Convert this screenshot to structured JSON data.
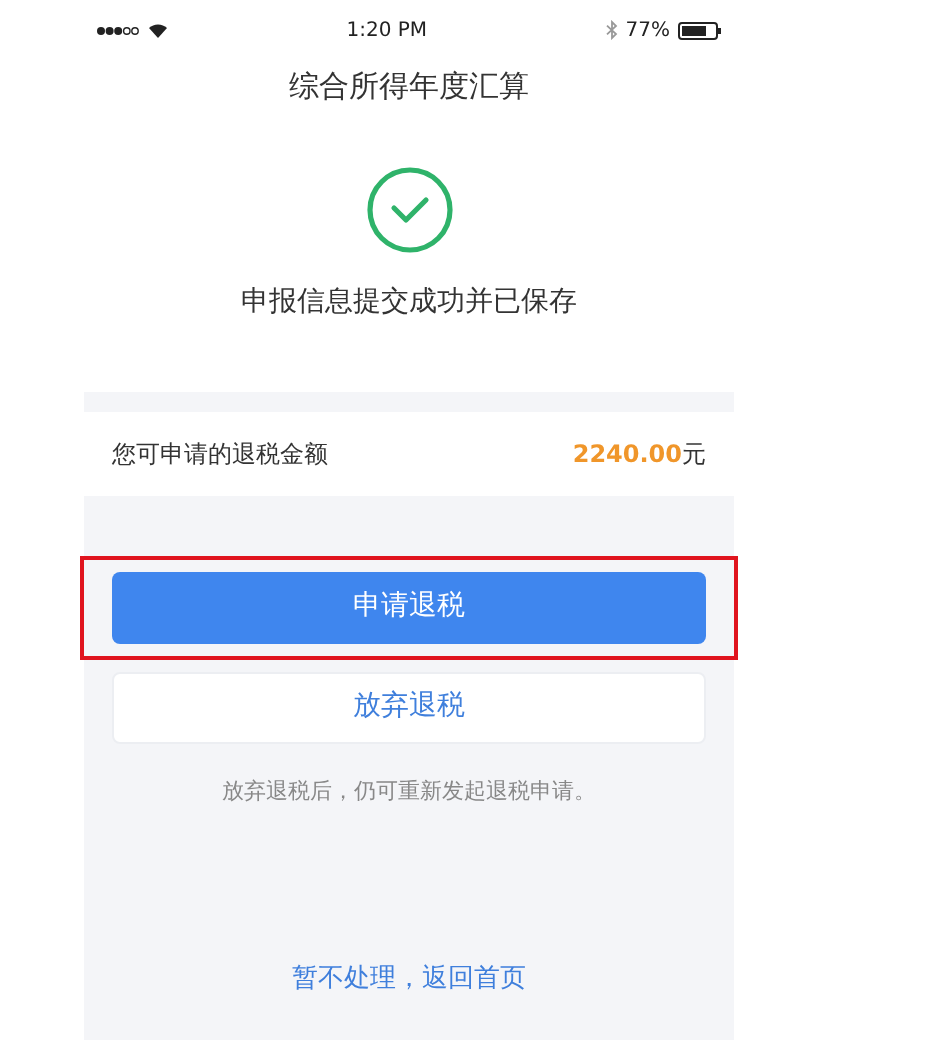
{
  "status_bar": {
    "time": "1:20 PM",
    "battery": "77%"
  },
  "title": "综合所得年度汇算",
  "result": {
    "message": "申报信息提交成功并已保存"
  },
  "refund": {
    "label": "您可申请的退税金额",
    "amount": "2240.00",
    "unit": "元"
  },
  "buttons": [
    {
      "label": "申请退税",
      "kind": "primary",
      "highlighted": true
    },
    {
      "label": "放弃退税",
      "kind": "secondary",
      "highlighted": false
    }
  ],
  "hint": "放弃退税后，仍可重新发起退税申请。",
  "back_link": "暂不处理，返回首页"
}
